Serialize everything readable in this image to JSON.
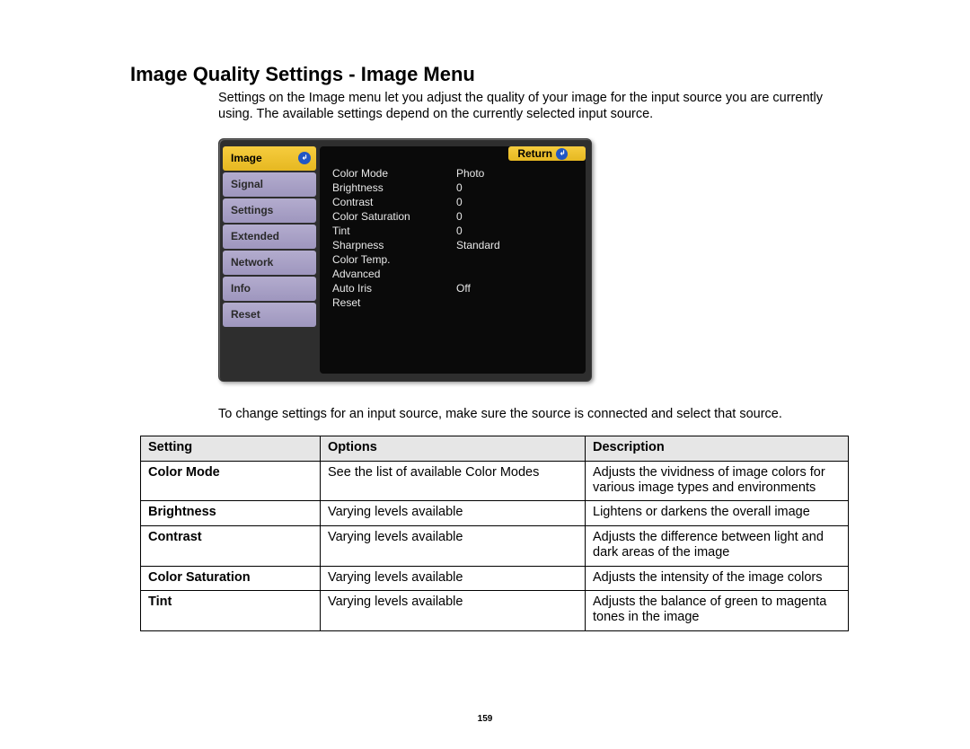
{
  "heading": "Image Quality Settings - Image Menu",
  "intro": "Settings on the Image menu let you adjust the quality of your image for the input source you are currently using. The available settings depend on the currently selected input source.",
  "osd": {
    "sidebar": [
      {
        "label": "Image",
        "active": true
      },
      {
        "label": "Signal",
        "active": false
      },
      {
        "label": "Settings",
        "active": false
      },
      {
        "label": "Extended",
        "active": false
      },
      {
        "label": "Network",
        "active": false
      },
      {
        "label": "Info",
        "active": false
      },
      {
        "label": "Reset",
        "active": false
      }
    ],
    "return_label": "Return",
    "rows": [
      {
        "label": "Color Mode",
        "value": "Photo"
      },
      {
        "label": "Brightness",
        "value": "0"
      },
      {
        "label": "Contrast",
        "value": "0"
      },
      {
        "label": "Color Saturation",
        "value": "0"
      },
      {
        "label": "Tint",
        "value": "0"
      },
      {
        "label": "Sharpness",
        "value": "Standard"
      },
      {
        "label": "Color Temp.",
        "value": ""
      },
      {
        "label": "Advanced",
        "value": ""
      },
      {
        "label": "Auto Iris",
        "value": "Off"
      },
      {
        "label": "Reset",
        "value": ""
      }
    ]
  },
  "note": "To change settings for an input source, make sure the source is connected and select that source.",
  "table": {
    "headers": {
      "c1": "Setting",
      "c2": "Options",
      "c3": "Description"
    },
    "rows": [
      {
        "setting": "Color Mode",
        "options": "See the list of available Color Modes",
        "description": "Adjusts the vividness of image colors for various image types and environments"
      },
      {
        "setting": "Brightness",
        "options": "Varying levels available",
        "description": "Lightens or darkens the overall image"
      },
      {
        "setting": "Contrast",
        "options": "Varying levels available",
        "description": "Adjusts the difference between light and dark areas of the image"
      },
      {
        "setting": "Color Saturation",
        "options": "Varying levels available",
        "description": "Adjusts the intensity of the image colors"
      },
      {
        "setting": "Tint",
        "options": "Varying levels available",
        "description": "Adjusts the balance of green to magenta tones in the image"
      }
    ]
  },
  "page_number": "159"
}
